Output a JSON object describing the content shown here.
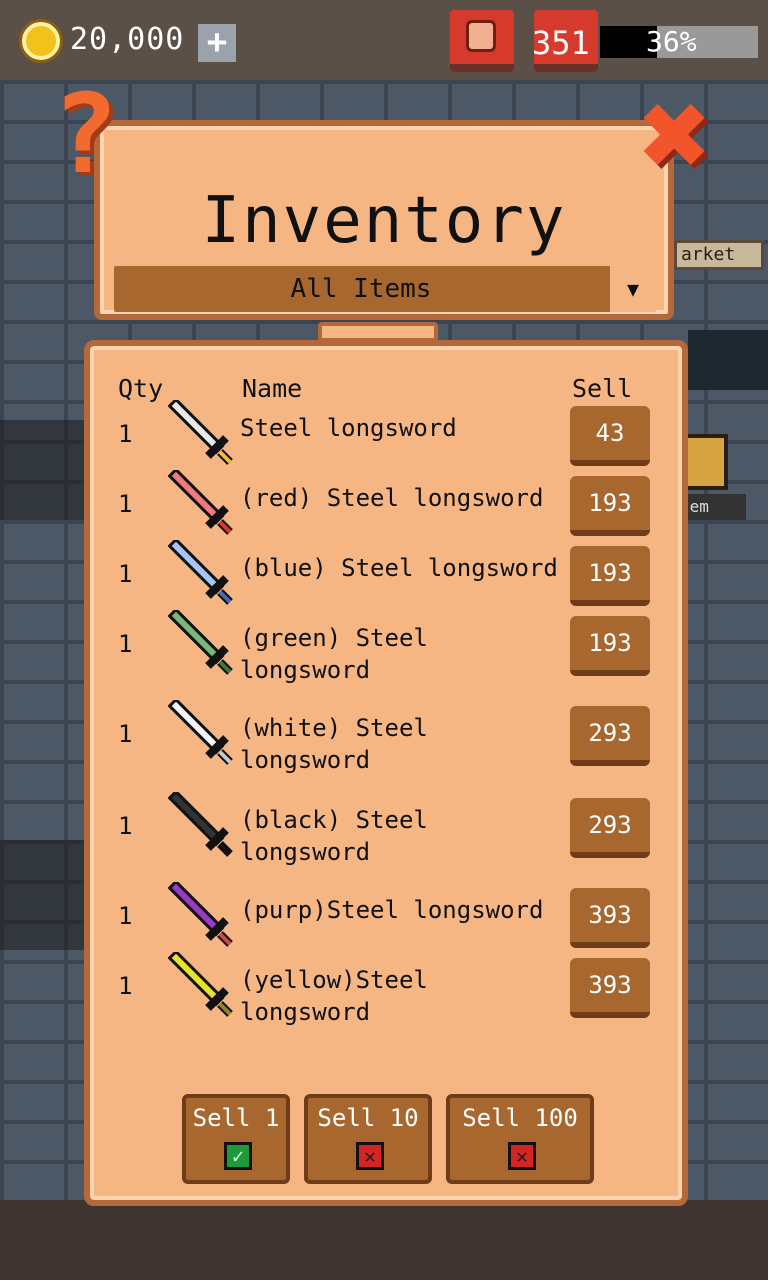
{
  "hud": {
    "coins": "20,000",
    "plus_label": "+",
    "energy": "351",
    "progress_text": "36%",
    "progress_value": 0.36
  },
  "background": {
    "market_label": "arket",
    "item_label": "tem"
  },
  "title_panel": {
    "title": "Inventory",
    "filter": "All Items",
    "filter_arrow": "▼",
    "help_label": "?",
    "close_label": "✖"
  },
  "inventory": {
    "headers": {
      "qty": "Qty",
      "name": "Name",
      "sell": "Sell"
    },
    "items": [
      {
        "qty": "1",
        "name": "Steel longsword",
        "sell": "43",
        "blade": "#e8e8e8",
        "hilt": "#f0c030"
      },
      {
        "qty": "1",
        "name": "(red) Steel longsword",
        "sell": "193",
        "blade": "#f07a7a",
        "hilt": "#d83a2a"
      },
      {
        "qty": "1",
        "name": "(blue) Steel longsword",
        "sell": "193",
        "blade": "#a8c4f4",
        "hilt": "#4a6ab0"
      },
      {
        "qty": "1",
        "name": "(green) Steel longsword",
        "sell": "193",
        "blade": "#7ab87a",
        "hilt": "#3a7a3a"
      },
      {
        "qty": "1",
        "name": "(white) Steel longsword",
        "sell": "293",
        "blade": "#f4f4f4",
        "hilt": "#c8c8c8"
      },
      {
        "qty": "1",
        "name": "(black) Steel longsword",
        "sell": "293",
        "blade": "#333333",
        "hilt": "#111111"
      },
      {
        "qty": "1",
        "name": "(purp)Steel longsword",
        "sell": "393",
        "blade": "#9a3ac8",
        "hilt": "#d04a4a"
      },
      {
        "qty": "1",
        "name": "(yellow)Steel longsword",
        "sell": "393",
        "blade": "#e8e030",
        "hilt": "#8a8a20"
      }
    ],
    "sell_options": [
      {
        "label": "Sell 1",
        "checked": true,
        "mark": "✓"
      },
      {
        "label": "Sell 10",
        "checked": false,
        "mark": "✕"
      },
      {
        "label": "Sell 100",
        "checked": false,
        "mark": "✕"
      }
    ]
  },
  "colors": {
    "panel": "#f5b684",
    "panel_border": "#b5683a",
    "button": "#a8672f",
    "accent_red": "#d63a2c"
  }
}
